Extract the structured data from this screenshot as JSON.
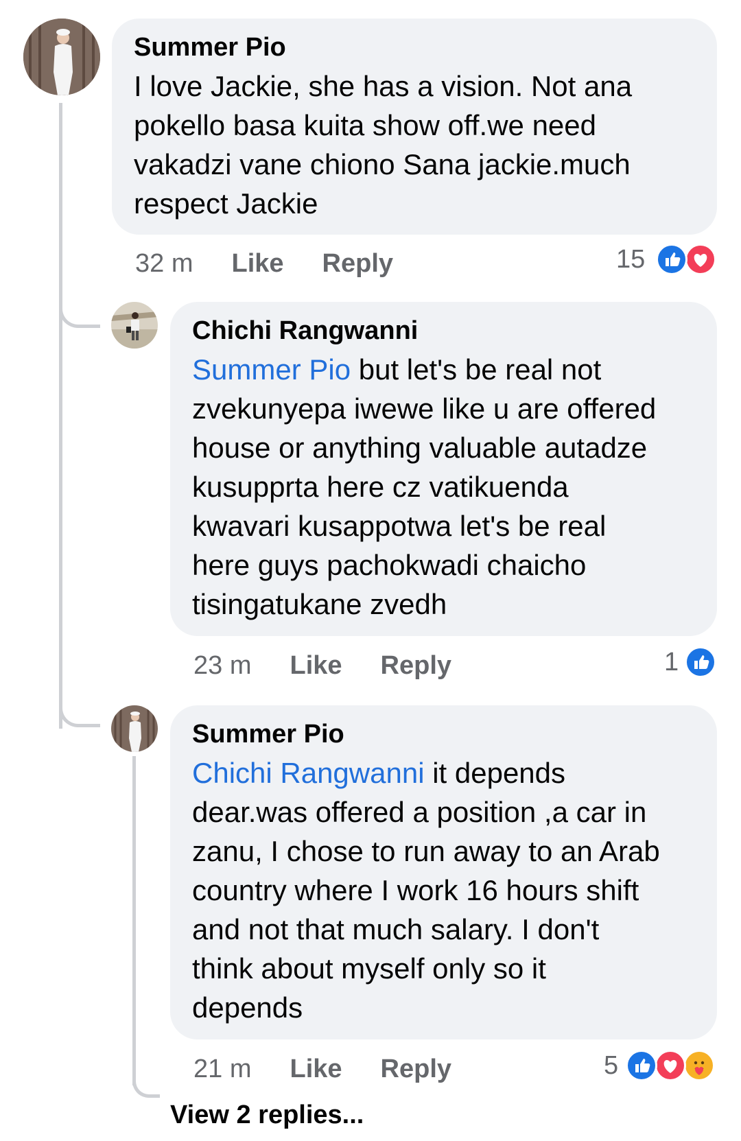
{
  "comments": [
    {
      "author": "Summer Pio",
      "text_lines": [
        "I love Jackie, she has a vision. Not ana",
        "pokello basa kuita show off.we need",
        "vakadzi vane chiono Sana jackie.much",
        "respect Jackie"
      ],
      "time": "32 m",
      "like_label": "Like",
      "reply_label": "Reply",
      "reaction_count": "15",
      "reactions": [
        "like-icon",
        "love-icon"
      ]
    },
    {
      "author": "Chichi Rangwanni",
      "mention": "Summer Pio",
      "text_first_rest": " but let's be real not",
      "text_lines": [
        "zvekunyepa iwewe like u are offered",
        "house or anything valuable autadze",
        "kusupprta here cz vatikuenda",
        "kwavari kusappotwa let's be real",
        "here guys pachokwadi chaicho",
        "tisingatukane zvedh"
      ],
      "time": "23 m",
      "like_label": "Like",
      "reply_label": "Reply",
      "reaction_count": "1",
      "reactions": [
        "like-icon"
      ]
    },
    {
      "author": "Summer Pio",
      "mention": "Chichi Rangwanni",
      "text_first_rest": " it depends",
      "text_lines": [
        "dear.was offered a position ,a car in",
        "zanu, I chose to run away to an Arab",
        "country where I work 16 hours shift",
        "and not that much salary. I don't",
        "think about myself only so it",
        "depends"
      ],
      "time": "21 m",
      "like_label": "Like",
      "reply_label": "Reply",
      "reaction_count": "5",
      "reactions": [
        "like-icon",
        "love-icon",
        "care-icon"
      ],
      "view_replies": "View 2 replies..."
    }
  ],
  "colors": {
    "bubble": "#f0f2f5",
    "mention": "#216fdb",
    "meta": "#65676b",
    "like": "#1b74e4",
    "love": "#f33e58",
    "care": "#f7b125"
  }
}
